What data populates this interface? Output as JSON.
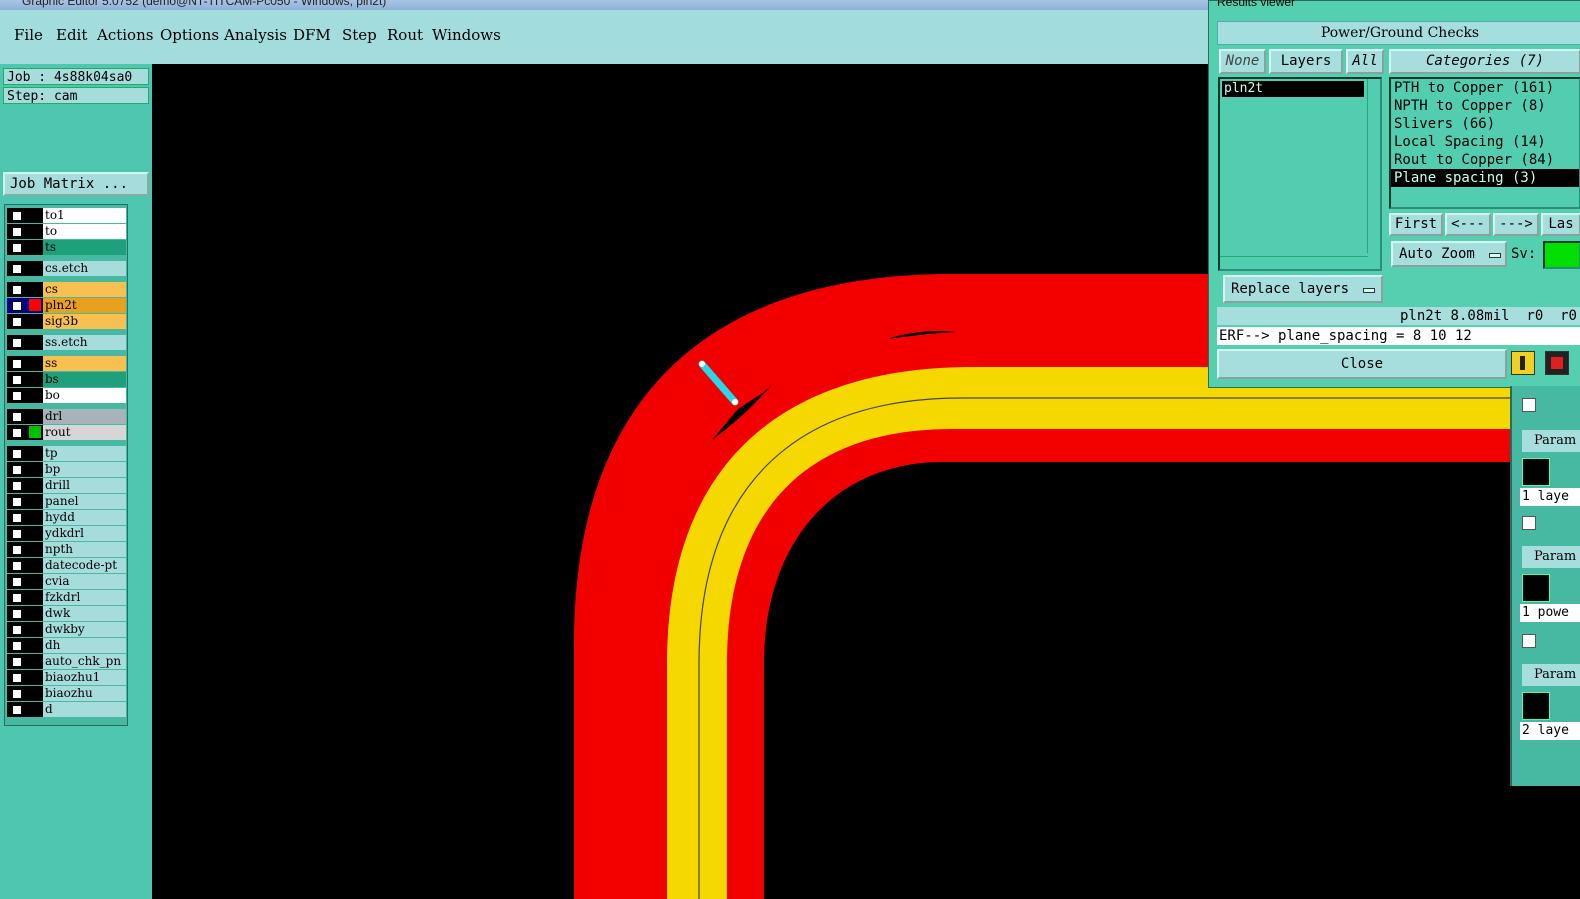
{
  "window": {
    "title": "Graphic Editor 5.0752 (demo@NT-TITCAM-Pc050 - Windows; pln2t)"
  },
  "menu": [
    "File",
    "Edit",
    "Actions",
    "Options",
    "Analysis",
    "DFM",
    "Step",
    "Rout",
    "Windows"
  ],
  "left_panel": {
    "job": "Job : 4s88k04sa0",
    "step": "Step: cam",
    "job_matrix_label": "Job Matrix ...",
    "layers": [
      {
        "name": "to1",
        "color": "#ffffff",
        "group": 1
      },
      {
        "name": "to",
        "color": "#ffffff",
        "group": 1
      },
      {
        "name": "ts",
        "color": "#1ea07a",
        "group": 1
      },
      {
        "name": "cs.etch",
        "color": "#a6dcdc",
        "group": 2
      },
      {
        "name": "cs",
        "color": "#f8c050",
        "group": 3
      },
      {
        "name": "pln2t",
        "color": "#e8a020",
        "group": 3,
        "active": true,
        "swatch": "#ff0000"
      },
      {
        "name": "sig3b",
        "color": "#f8c050",
        "group": 3
      },
      {
        "name": "ss.etch",
        "color": "#a6dcdc",
        "group": 4
      },
      {
        "name": "ss",
        "color": "#f8c050",
        "group": 5
      },
      {
        "name": "bs",
        "color": "#1ea07a",
        "group": 5
      },
      {
        "name": "bo",
        "color": "#ffffff",
        "group": 5
      },
      {
        "name": "drl",
        "color": "#a7b3b8",
        "group": 6
      },
      {
        "name": "rout",
        "color": "#d6d6d6",
        "group": 6,
        "swatch": "#00c000"
      },
      {
        "name": "tp",
        "color": "#a6dcdc",
        "group": 7
      },
      {
        "name": "bp",
        "color": "#a6dcdc",
        "group": 7
      },
      {
        "name": "drill",
        "color": "#a6dcdc",
        "group": 7
      },
      {
        "name": "panel",
        "color": "#a6dcdc",
        "group": 7
      },
      {
        "name": "hydd",
        "color": "#a6dcdc",
        "group": 7
      },
      {
        "name": "ydkdrl",
        "color": "#a6dcdc",
        "group": 7
      },
      {
        "name": "npth",
        "color": "#a6dcdc",
        "group": 7
      },
      {
        "name": "datecode-pt",
        "color": "#a6dcdc",
        "group": 7
      },
      {
        "name": "cvia",
        "color": "#a6dcdc",
        "group": 7
      },
      {
        "name": "fzkdrl",
        "color": "#a6dcdc",
        "group": 7
      },
      {
        "name": "dwk",
        "color": "#a6dcdc",
        "group": 7
      },
      {
        "name": "dwkby",
        "color": "#a6dcdc",
        "group": 7
      },
      {
        "name": "dh",
        "color": "#a6dcdc",
        "group": 7
      },
      {
        "name": "auto_chk_pn",
        "color": "#a6dcdc",
        "group": 7
      },
      {
        "name": "biaozhu1",
        "color": "#a6dcdc",
        "group": 7
      },
      {
        "name": "biaozhu",
        "color": "#a6dcdc",
        "group": 7
      },
      {
        "name": "d",
        "color": "#a6dcdc",
        "group": 7
      }
    ]
  },
  "results_viewer": {
    "title": "Results viewer",
    "header": "Power/Ground Checks",
    "none_label": "None",
    "layers_label": "Layers",
    "all_label": "All",
    "layer_items": [
      "pln2t"
    ],
    "categories_label": "Categories (7)",
    "categories": [
      "PTH to Copper (161)",
      "NPTH to Copper (8)",
      "Slivers (66)",
      "Local Spacing (14)",
      "Rout to Copper (84)",
      "Plane spacing (3)"
    ],
    "selected_category": "Plane spacing (3)",
    "first_label": "First",
    "prev_label": "<---",
    "next_label": "--->",
    "last_label": "Las",
    "auto_zoom_label": "Auto Zoom",
    "sv_label": "Sv:",
    "replace_layers_label": "Replace layers",
    "measure_text": "pln2t 8.08mil  r0  r0",
    "erf_text": "ERF--> plane_spacing = 8 10 12",
    "close_label": "Close"
  },
  "right_strip": {
    "param_labels": [
      "Param",
      "Param",
      "Param"
    ],
    "layer_notes": [
      "1 laye",
      "1 powe",
      "2 laye"
    ]
  },
  "colors": {
    "menu_bg": "#a3dcdc",
    "panel_bg": "#4fc6b0",
    "canvas_bg": "#000000",
    "plane_red": "#f20000",
    "trace_yellow": "#f4d800",
    "measure_cyan": "#28d8e8"
  }
}
